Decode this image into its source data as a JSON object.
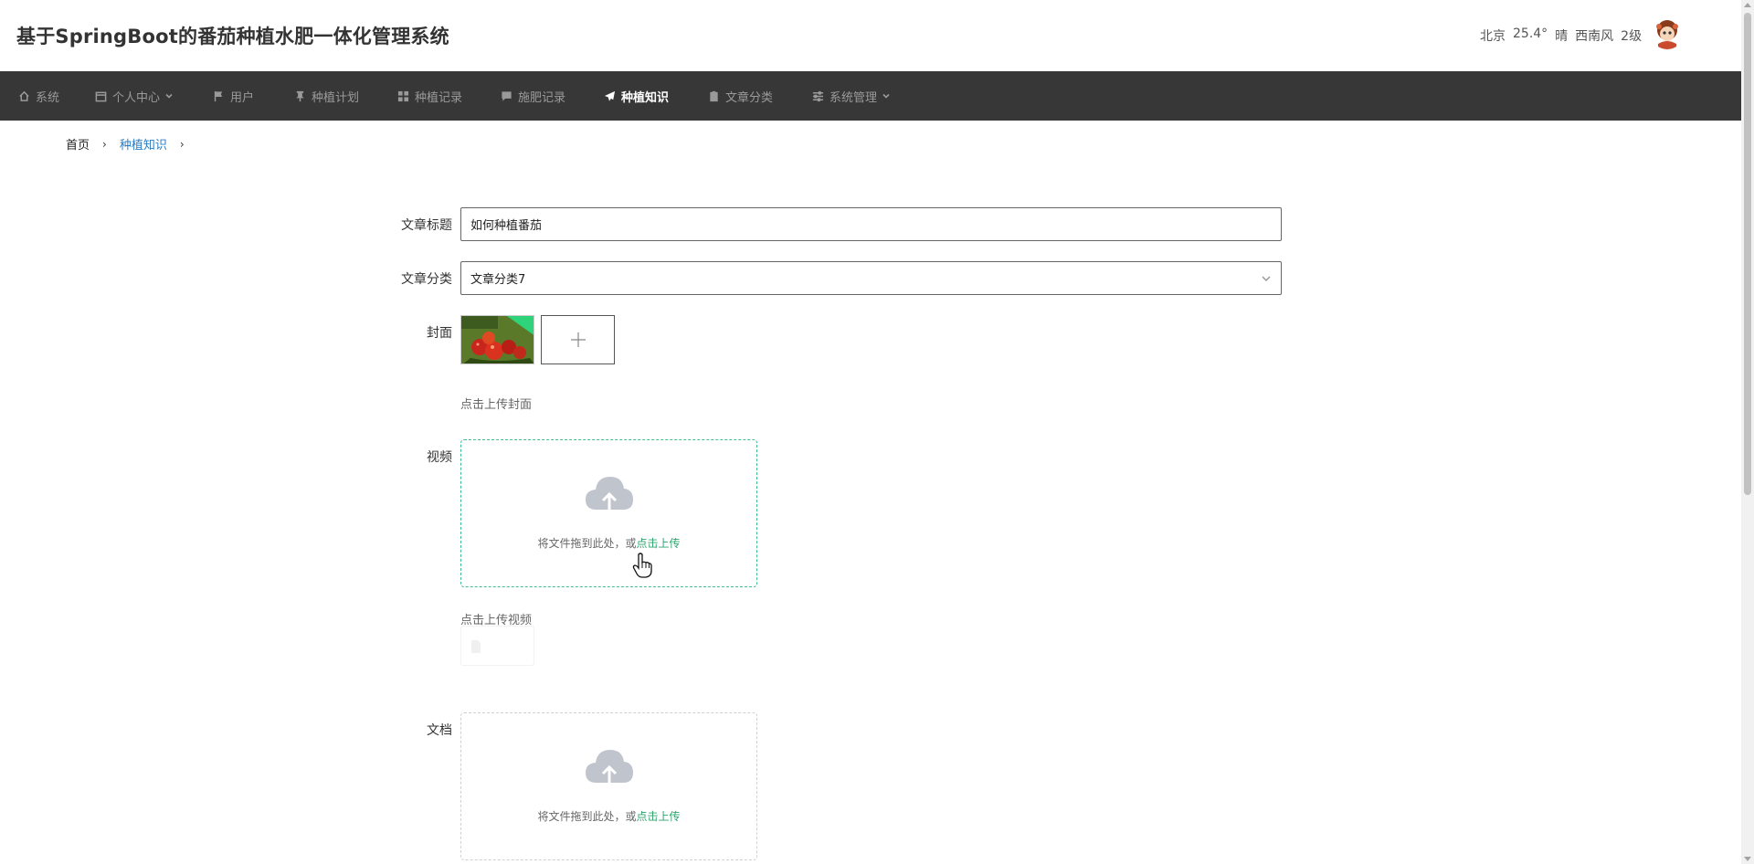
{
  "header": {
    "title": "基于SpringBoot的番茄种植水肥一体化管理系统",
    "weather": {
      "city": "北京",
      "temperature": "25.4°",
      "condition": "晴",
      "wind": "西南风",
      "wind_level": "2级"
    }
  },
  "nav": {
    "items": [
      {
        "label": "系统",
        "icon": "home-icon"
      },
      {
        "label": "个人中心",
        "icon": "calendar-icon",
        "has_dropdown": true
      },
      {
        "label": "用户",
        "icon": "flag-icon"
      },
      {
        "label": "种植计划",
        "icon": "pin-icon"
      },
      {
        "label": "种植记录",
        "icon": "grid-icon"
      },
      {
        "label": "施肥记录",
        "icon": "comment-icon"
      },
      {
        "label": "种植知识",
        "icon": "paper-plane-icon",
        "active": true
      },
      {
        "label": "文章分类",
        "icon": "clipboard-icon"
      },
      {
        "label": "系统管理",
        "icon": "sliders-icon",
        "has_dropdown": true
      }
    ],
    "colors": {
      "background": "#373737",
      "text": "#9a9a9a",
      "active_text": "#ffffff"
    }
  },
  "breadcrumb": {
    "home": "首页",
    "current": "种植知识",
    "separator": "›"
  },
  "form": {
    "title_label": "文章标题",
    "title_value": "如何种植番茄",
    "category_label": "文章分类",
    "category_value": "文章分类7",
    "cover_label": "封面",
    "cover_hint": "点击上传封面",
    "video_label": "视频",
    "video_dropzone_text": "将文件拖到此处，或",
    "video_dropzone_link": "点击上传",
    "video_hint": "点击上传视频",
    "doc_label": "文档",
    "doc_dropzone_text": "将文件拖到此处，或",
    "doc_dropzone_link": "点击上传"
  },
  "colors": {
    "link_green": "#2fa46f",
    "dropzone_focus": "#3fbf8c",
    "breadcrumb_link": "#2b7cc2"
  }
}
